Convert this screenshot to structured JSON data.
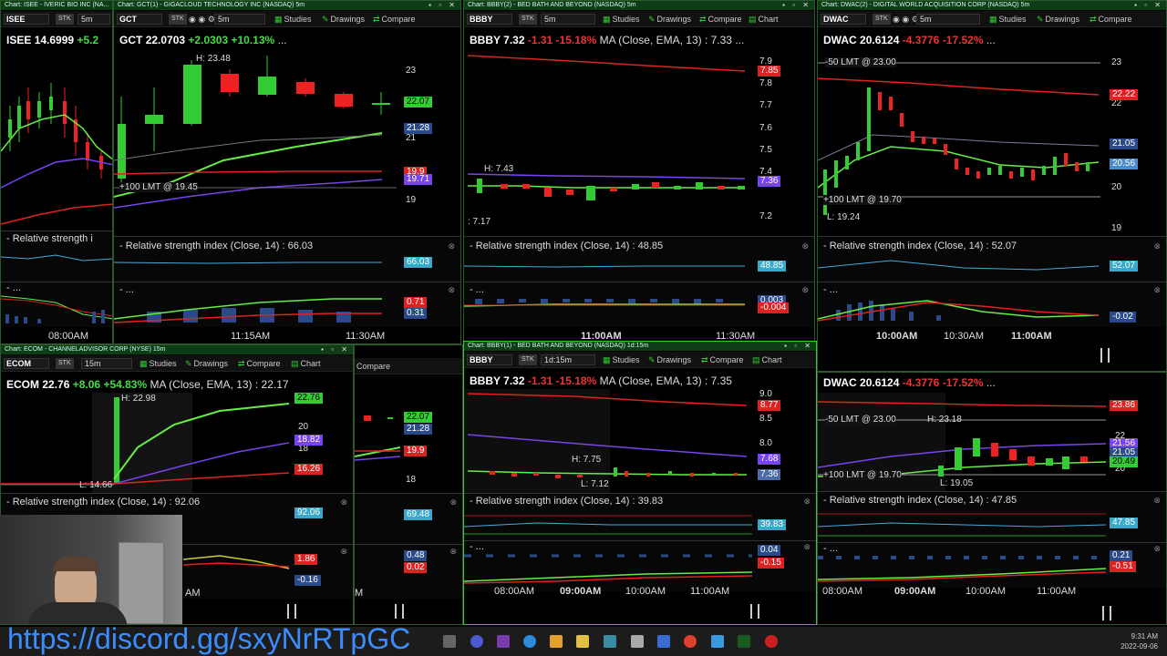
{
  "windows": {
    "isee": {
      "title": "Chart: ISEE - IVERIC BIO INC (NA...",
      "symbol": "ISEE",
      "type": "STK",
      "timeframe": "5m",
      "header": {
        "sym": "ISEE",
        "price": "14.6999",
        "change": "+5.2"
      },
      "rsi_title": "- Relative strength i",
      "time_labels": [
        "08:00AM"
      ]
    },
    "gct": {
      "title": "Chart: GCT(1) - GIGACLOUD TECHNOLOGY INC (NASDAQ) 5m",
      "symbol": "GCT",
      "type": "STK",
      "timeframe": "5m",
      "buttons": [
        "Studies",
        "Drawings",
        "Compare"
      ],
      "header": {
        "sym": "GCT",
        "price": "22.0703",
        "change": "+2.0303",
        "pct": "+10.13%"
      },
      "high": "H: 23.48",
      "order": "+100 LMT @ 19.45",
      "axis": [
        "23",
        "21",
        "20",
        "19"
      ],
      "tags": {
        "last": "22.07",
        "ema": "21.28",
        "red": "19.9",
        "purple": "19.71"
      },
      "rsi_title": "- Relative strength index (Close, 14) : 66.03",
      "rsi_value": "66.03",
      "macd_title": "- ...",
      "macd_values": [
        "0.71",
        "0.31"
      ],
      "time_labels": [
        "11:15AM",
        "11:30AM"
      ]
    },
    "bbby1": {
      "title": "Chart: BBBY(2) - BED BATH AND BEYOND (NASDAQ) 5m",
      "symbol": "BBBY",
      "type": "STK",
      "timeframe": "5m",
      "buttons": [
        "Studies",
        "Drawings",
        "Compare",
        "Chart"
      ],
      "header": {
        "sym": "BBBY",
        "price": "7.32",
        "change": "-1.31",
        "pct": "-15.18%",
        "ma": "MA (Close, EMA, 13) : 7.33"
      },
      "high": "H: 7.43",
      "low": ": 7.17",
      "axis": [
        "7.9",
        "7.8",
        "7.7",
        "7.6",
        "7.5",
        "7.4",
        "7.3",
        "7.2"
      ],
      "tags": {
        "red": "7.85",
        "purple": "7.36"
      },
      "rsi_title": "- Relative strength index (Close, 14) : 48.85",
      "rsi_value": "48.85",
      "macd_title": "- ...",
      "macd_values": [
        "0.003",
        "-0.004"
      ],
      "time_labels": [
        "11:00AM",
        "11:30AM"
      ]
    },
    "dwac1": {
      "title": "Chart: DWAC(2) - DIGITAL WORLD ACQUISITION CORP (NASDAQ) 5m",
      "symbol": "DWAC",
      "type": "STK",
      "timeframe": "5m",
      "buttons": [
        "Studies",
        "Drawings",
        "Compare"
      ],
      "header": {
        "sym": "DWAC",
        "price": "20.6124",
        "change": "-4.3776",
        "pct": "-17.52%"
      },
      "order_sell": "-50 LMT @ 23.00",
      "order_buy": "+100 LMT @ 19.70",
      "low": "L: 19.24",
      "axis": [
        "23",
        "22",
        "20",
        "19"
      ],
      "tags": {
        "red": "22.22",
        "ema": "21.05",
        "last": "20.56"
      },
      "rsi_title": "- Relative strength index (Close, 14) : 52.07",
      "rsi_value": "52.07",
      "macd_title": "- ...",
      "macd_values": [
        "-0.02"
      ],
      "time_labels": [
        "10:00AM",
        "10:30AM",
        "11:00AM"
      ]
    },
    "ecom": {
      "title": "Chart: ECOM - CHANNELADVISOR CORP (NYSE) 15m",
      "symbol": "ECOM",
      "type": "STK",
      "timeframe": "15m",
      "buttons": [
        "Studies",
        "Drawings",
        "Compare",
        "Chart"
      ],
      "header": {
        "sym": "ECOM",
        "price": "22.76",
        "change": "+8.06",
        "pct": "+54.83%",
        "ma": "MA (Close, EMA, 13) : 22.17"
      },
      "high": "H: 22.98",
      "low": "L: 14.66",
      "axis": [
        "20",
        "18"
      ],
      "tags": {
        "last": "22.76",
        "purple": "18.82",
        "red": "16.26"
      },
      "rsi_title": "- Relative strength index (Close, 14) : 92.06",
      "rsi_value": "92.06",
      "macd_values": [
        "1.86",
        "-0.16"
      ],
      "time_labels": [
        "AM"
      ]
    },
    "gct2": {
      "buttons": [
        "Compare"
      ],
      "tags": [
        "22.07",
        "21.28",
        "19.9",
        "18"
      ],
      "rsi_value": "69.48",
      "macd_values": [
        "0.48",
        "0.02"
      ],
      "time_labels": [
        "M"
      ]
    },
    "bbby2": {
      "title": "Chart: BBBY(1) - BED BATH AND BEYOND (NASDAQ) 1d:15m",
      "symbol": "BBBY",
      "type": "STK",
      "timeframe": "1d:15m",
      "buttons": [
        "Studies",
        "Drawings",
        "Compare",
        "Chart"
      ],
      "header": {
        "sym": "BBBY",
        "price": "7.32",
        "change": "-1.31",
        "pct": "-15.18%",
        "ma": "MA (Close, EMA, 13) : 7.35"
      },
      "high": "H: 7.75",
      "low": "L: 7.12",
      "axis": [
        "9.0",
        "8.5",
        "8.0",
        "7.5"
      ],
      "tags": {
        "red": "8.77",
        "purple": "7.68",
        "last": "7.36"
      },
      "rsi_title": "- Relative strength index (Close, 14) : 39.83",
      "rsi_value": "39.83",
      "macd_title": "- ...",
      "macd_values": [
        "0.04",
        "-0.15"
      ],
      "time_labels": [
        "08:00AM",
        "09:00AM",
        "10:00AM",
        "11:00AM"
      ]
    },
    "dwac2": {
      "header": {
        "sym": "DWAC",
        "price": "20.6124",
        "change": "-4.3776",
        "pct": "-17.52%"
      },
      "order_sell": "-50 LMT @ 23.00",
      "high": "H: 23.18",
      "order_buy": "+100 LMT @ 19.70",
      "low": "L: 19.05",
      "axis": [
        "22",
        "20"
      ],
      "tags": {
        "red": "23.86",
        "purple": "21.56",
        "ema": "21.05",
        "last": "20.49"
      },
      "rsi_title": "- Relative strength index (Close, 14) : 47.85",
      "rsi_value": "47.85",
      "macd_title": "- ...",
      "macd_values": [
        "0.21",
        "-0.51"
      ],
      "time_labels": [
        "08:00AM",
        "09:00AM",
        "10:00AM",
        "11:00AM"
      ]
    }
  },
  "overlay": {
    "discord": "https://discord.gg/sxyNrRTpGC"
  },
  "clock": {
    "time": "9:31 AM",
    "date": "2022-09-06"
  },
  "colors": {
    "up": "#44cc33",
    "down": "#e02020",
    "ema": "#66ee44",
    "purple": "#7744ee",
    "red_line": "#dd2020"
  }
}
